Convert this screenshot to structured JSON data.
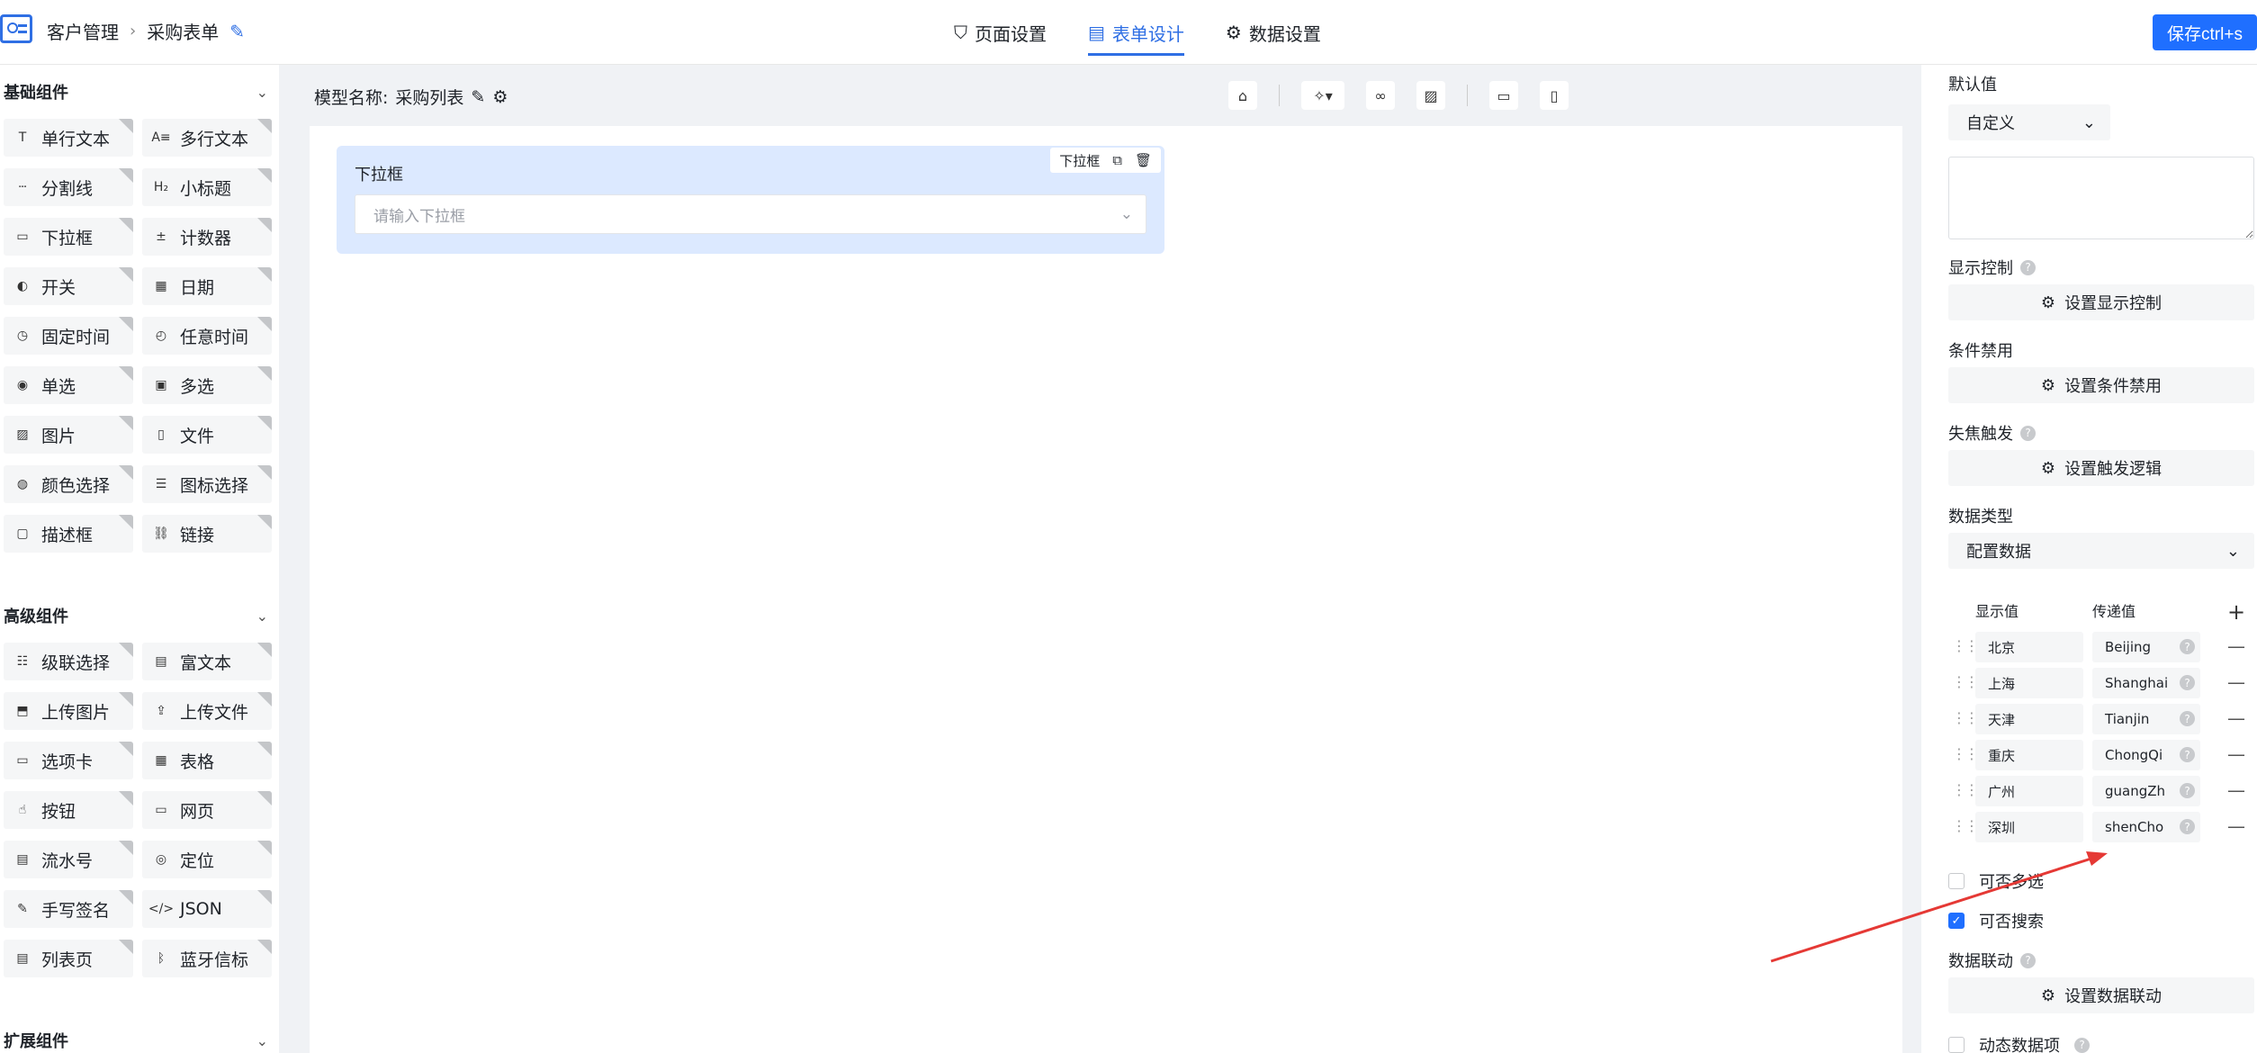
{
  "header": {
    "breadcrumb": [
      "客户管理",
      "采购表单"
    ],
    "tabs": [
      {
        "icon": "bookmark-icon",
        "label": "页面设置",
        "active": false
      },
      {
        "icon": "document-icon",
        "label": "表单设计",
        "active": true
      },
      {
        "icon": "gear-icon",
        "label": "数据设置",
        "active": false
      }
    ],
    "save_label": "保存ctrl+s",
    "accent_color": "#1f6fff"
  },
  "left_panel": {
    "sections": [
      {
        "title": "基础组件",
        "items": [
          {
            "icon": "text-icon",
            "glyph": "T",
            "label": "单行文本"
          },
          {
            "icon": "multiline-text-icon",
            "glyph": "A≡",
            "label": "多行文本"
          },
          {
            "icon": "divider-icon",
            "glyph": "┄",
            "label": "分割线"
          },
          {
            "icon": "heading-icon",
            "glyph": "H₂",
            "label": "小标题"
          },
          {
            "icon": "dropdown-icon",
            "glyph": "▭",
            "label": "下拉框"
          },
          {
            "icon": "counter-icon",
            "glyph": "±",
            "label": "计数器"
          },
          {
            "icon": "toggle-icon",
            "glyph": "◐",
            "label": "开关"
          },
          {
            "icon": "calendar-icon",
            "glyph": "▦",
            "label": "日期"
          },
          {
            "icon": "timer-icon",
            "glyph": "◷",
            "label": "固定时间"
          },
          {
            "icon": "clock-icon",
            "glyph": "◴",
            "label": "任意时间"
          },
          {
            "icon": "radio-icon",
            "glyph": "◉",
            "label": "单选"
          },
          {
            "icon": "checkbox-icon",
            "glyph": "▣",
            "label": "多选"
          },
          {
            "icon": "image-icon",
            "glyph": "▨",
            "label": "图片"
          },
          {
            "icon": "file-icon",
            "glyph": "▯",
            "label": "文件"
          },
          {
            "icon": "palette-icon",
            "glyph": "◍",
            "label": "颜色选择"
          },
          {
            "icon": "icon-picker-icon",
            "glyph": "☰",
            "label": "图标选择"
          },
          {
            "icon": "frame-icon",
            "glyph": "▢",
            "label": "描述框"
          },
          {
            "icon": "link-icon",
            "glyph": "⛓",
            "label": "链接"
          }
        ]
      },
      {
        "title": "高级组件",
        "items": [
          {
            "icon": "cascade-icon",
            "glyph": "☷",
            "label": "级联选择"
          },
          {
            "icon": "rich-text-icon",
            "glyph": "▤",
            "label": "富文本"
          },
          {
            "icon": "upload-image-icon",
            "glyph": "⬒",
            "label": "上传图片"
          },
          {
            "icon": "upload-file-icon",
            "glyph": "⇪",
            "label": "上传文件"
          },
          {
            "icon": "tabs-icon",
            "glyph": "▭",
            "label": "选项卡"
          },
          {
            "icon": "table-icon",
            "glyph": "▦",
            "label": "表格"
          },
          {
            "icon": "button-icon",
            "glyph": "☝",
            "label": "按钮"
          },
          {
            "icon": "webpage-icon",
            "glyph": "▭",
            "label": "网页"
          },
          {
            "icon": "serial-icon",
            "glyph": "▤",
            "label": "流水号"
          },
          {
            "icon": "location-icon",
            "glyph": "◎",
            "label": "定位"
          },
          {
            "icon": "signature-icon",
            "glyph": "✎",
            "label": "手写签名"
          },
          {
            "icon": "json-icon",
            "glyph": "</>",
            "label": "JSON"
          },
          {
            "icon": "list-page-icon",
            "glyph": "▤",
            "label": "列表页"
          },
          {
            "icon": "bluetooth-icon",
            "glyph": "ᛒ",
            "label": "蓝牙信标"
          }
        ]
      },
      {
        "title": "扩展组件",
        "items": []
      }
    ]
  },
  "canvas": {
    "model_name_label": "模型名称:",
    "model_name": "采购列表",
    "field": {
      "label": "下拉框",
      "tag": "下拉框",
      "placeholder": "请输入下拉框"
    }
  },
  "right_panel": {
    "default_value_label": "默认值",
    "default_value_select": "自定义",
    "display_control_label": "显示控制",
    "display_control_btn": "设置显示控制",
    "condition_disable_label": "条件禁用",
    "condition_disable_btn": "设置条件禁用",
    "blur_trigger_label": "失焦触发",
    "blur_trigger_btn": "设置触发逻辑",
    "data_type_label": "数据类型",
    "data_type_select": "配置数据",
    "options_header": {
      "show": "显示值",
      "pass": "传递值"
    },
    "options": [
      {
        "show": "北京",
        "pass": "Beijing"
      },
      {
        "show": "上海",
        "pass": "Shanghai"
      },
      {
        "show": "天津",
        "pass": "Tianjin"
      },
      {
        "show": "重庆",
        "pass": "ChongQi"
      },
      {
        "show": "广州",
        "pass": "guangZh"
      },
      {
        "show": "深圳",
        "pass": "shenCho"
      }
    ],
    "multi_select": {
      "label": "可否多选",
      "checked": false
    },
    "searchable": {
      "label": "可否搜索",
      "checked": true
    },
    "data_link_label": "数据联动",
    "data_link_btn": "设置数据联动",
    "dynamic_item": {
      "label": "动态数据项",
      "checked": false
    }
  }
}
